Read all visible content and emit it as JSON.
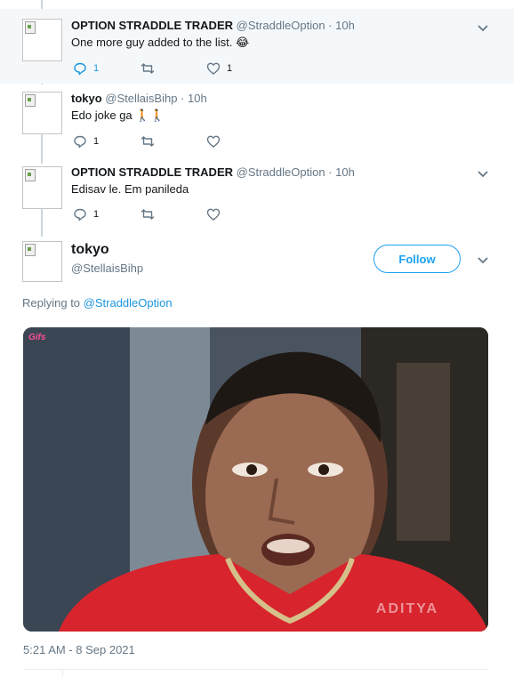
{
  "replies": [
    {
      "name": "OPTION STRADDLE TRADER",
      "handle": "@StraddleOption",
      "dot": "·",
      "time": "10h",
      "text": "One more guy added to the  list. 😂",
      "reply_count": "1",
      "retweet_count": "",
      "like_count": "1"
    },
    {
      "name": "tokyo",
      "handle": "@StellaisBihp",
      "dot": "·",
      "time": "10h",
      "text": "Edo joke ga 🚶🚶",
      "reply_count": "1",
      "retweet_count": "",
      "like_count": ""
    },
    {
      "name": "OPTION STRADDLE TRADER",
      "handle": "@StraddleOption",
      "dot": "·",
      "time": "10h",
      "text": "Edisav le.  Em panileda",
      "reply_count": "1",
      "retweet_count": "",
      "like_count": ""
    }
  ],
  "focus": {
    "name": "tokyo",
    "handle": "@StellaisBihp",
    "follow_label": "Follow",
    "replying_prefix": "Replying to ",
    "replying_to": "@StraddleOption",
    "media_watermark": "Gifs",
    "media_channel": "ADITYA",
    "timestamp": "5:21 AM - 8 Sep 2021"
  },
  "icons": {
    "reply": "reply-icon",
    "retweet": "retweet-icon",
    "like": "heart-icon",
    "more": "chevron-down-icon"
  },
  "colors": {
    "accent": "#1da1f2",
    "link": "#1b95e0",
    "muted": "#657786",
    "highlight_bg": "#f5f8fa"
  }
}
